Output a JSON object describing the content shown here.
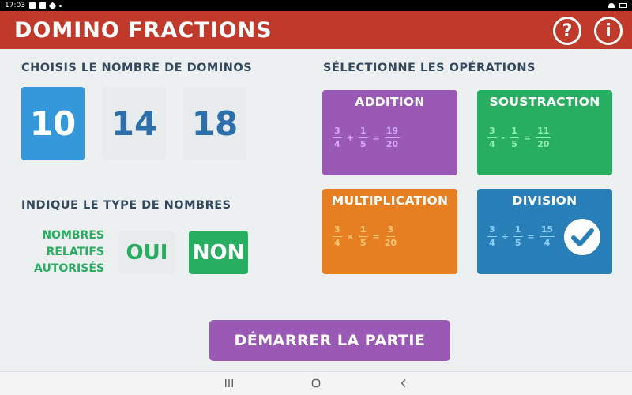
{
  "statusbar": {
    "time": "17:03"
  },
  "header": {
    "title": "DOMINO FRACTIONS",
    "help_label": "?",
    "info_label": "i"
  },
  "dominos": {
    "title": "CHOISIS LE NOMBRE DE DOMINOS",
    "options": [
      {
        "label": "10",
        "selected": true
      },
      {
        "label": "14",
        "selected": false
      },
      {
        "label": "18",
        "selected": false
      }
    ]
  },
  "number_type": {
    "title": "INDIQUE LE TYPE DE NOMBRES",
    "label_lines": [
      "NOMBRES",
      "RELATIFS",
      "AUTORISÉS"
    ],
    "yes_label": "OUI",
    "no_label": "NON",
    "selected": "NON"
  },
  "operations": {
    "title": "SÉLECTIONNE LES OPÉRATIONS",
    "items": [
      {
        "title": "ADDITION",
        "selected": false,
        "color": "#9b59b6",
        "f1": [
          "3",
          "4"
        ],
        "op": "+",
        "f2": [
          "1",
          "5"
        ],
        "res": [
          "19",
          "20"
        ]
      },
      {
        "title": "SOUSTRACTION",
        "selected": false,
        "color": "#27ae60",
        "f1": [
          "3",
          "4"
        ],
        "op": "-",
        "f2": [
          "1",
          "5"
        ],
        "res": [
          "11",
          "20"
        ]
      },
      {
        "title": "MULTIPLICATION",
        "selected": false,
        "color": "#e67e22",
        "f1": [
          "3",
          "4"
        ],
        "op": "×",
        "f2": [
          "1",
          "5"
        ],
        "res": [
          "3",
          "20"
        ]
      },
      {
        "title": "DIVISION",
        "selected": true,
        "color": "#2980b9",
        "f1": [
          "3",
          "4"
        ],
        "op": "÷",
        "f2": [
          "1",
          "5"
        ],
        "res": [
          "15",
          "4"
        ]
      }
    ]
  },
  "start": {
    "label": "DÉMARRER LA PARTIE"
  },
  "navbar": {
    "recent_icon": "recent-apps-icon",
    "home_icon": "home-icon",
    "back_icon": "back-icon"
  }
}
